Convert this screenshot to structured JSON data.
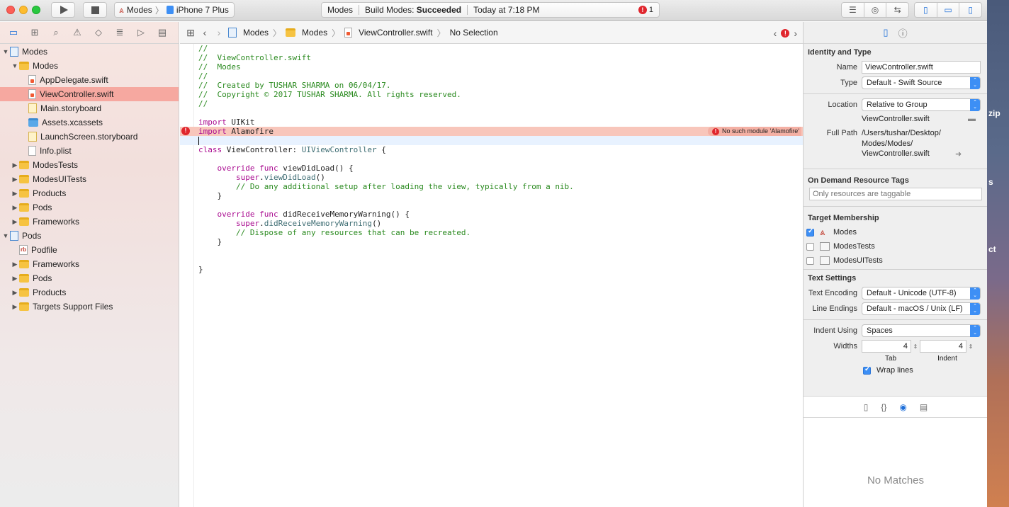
{
  "toolbar": {
    "scheme_target": "Modes",
    "scheme_device": "iPhone 7 Plus",
    "activity_project": "Modes",
    "activity_status_label": "Build Modes:",
    "activity_status_value": "Succeeded",
    "activity_time": "Today at 7:18 PM",
    "error_count": "1"
  },
  "navigator": {
    "items": [
      {
        "label": "Modes",
        "indent": 0,
        "icon": "project-icon",
        "disclosure": "▼"
      },
      {
        "label": "Modes",
        "indent": 1,
        "icon": "folder-icon",
        "disclosure": "▼"
      },
      {
        "label": "AppDelegate.swift",
        "indent": 2,
        "icon": "swift-file-icon",
        "disclosure": ""
      },
      {
        "label": "ViewController.swift",
        "indent": 2,
        "icon": "swift-file-icon",
        "disclosure": "",
        "selected": true
      },
      {
        "label": "Main.storyboard",
        "indent": 2,
        "icon": "storyboard-icon",
        "disclosure": ""
      },
      {
        "label": "Assets.xcassets",
        "indent": 2,
        "icon": "assets-folder-icon",
        "disclosure": ""
      },
      {
        "label": "LaunchScreen.storyboard",
        "indent": 2,
        "icon": "storyboard-icon",
        "disclosure": ""
      },
      {
        "label": "Info.plist",
        "indent": 2,
        "icon": "plist-file-icon",
        "disclosure": ""
      },
      {
        "label": "ModesTests",
        "indent": 1,
        "icon": "folder-icon",
        "disclosure": "▶"
      },
      {
        "label": "ModesUITests",
        "indent": 1,
        "icon": "folder-icon",
        "disclosure": "▶"
      },
      {
        "label": "Products",
        "indent": 1,
        "icon": "folder-icon",
        "disclosure": "▶"
      },
      {
        "label": "Pods",
        "indent": 1,
        "icon": "folder-icon",
        "disclosure": "▶"
      },
      {
        "label": "Frameworks",
        "indent": 1,
        "icon": "folder-icon",
        "disclosure": "▶"
      },
      {
        "label": "Pods",
        "indent": 0,
        "icon": "project-icon",
        "disclosure": "▼"
      },
      {
        "label": "Podfile",
        "indent": 1,
        "icon": "podfile-icon",
        "disclosure": ""
      },
      {
        "label": "Frameworks",
        "indent": 1,
        "icon": "folder-icon",
        "disclosure": "▶"
      },
      {
        "label": "Pods",
        "indent": 1,
        "icon": "folder-icon",
        "disclosure": "▶"
      },
      {
        "label": "Products",
        "indent": 1,
        "icon": "folder-icon",
        "disclosure": "▶"
      },
      {
        "label": "Targets Support Files",
        "indent": 1,
        "icon": "folder-icon",
        "disclosure": "▶"
      }
    ]
  },
  "jumpbar": {
    "crumb1": "Modes",
    "crumb2": "Modes",
    "crumb3": "ViewController.swift",
    "crumb4": "No Selection"
  },
  "editor": {
    "error_message": "No such module 'Alamofire'",
    "lines": [
      {
        "t": "//",
        "c": "cm"
      },
      {
        "t": "//  ViewController.swift",
        "c": "cm"
      },
      {
        "t": "//  Modes",
        "c": "cm"
      },
      {
        "t": "//",
        "c": "cm"
      },
      {
        "t": "//  Created by TUSHAR SHARMA on 06/04/17.",
        "c": "cm"
      },
      {
        "t": "//  Copyright © 2017 TUSHAR SHARMA. All rights reserved.",
        "c": "cm"
      },
      {
        "t": "//",
        "c": "cm"
      },
      {
        "t": "",
        "c": ""
      },
      {
        "t": "import UIKit",
        "c": "import"
      },
      {
        "t": "import Alamofire",
        "c": "import",
        "err": true
      },
      {
        "t": "",
        "c": "",
        "cursor": true
      },
      {
        "t": "class ViewController: UIViewController {",
        "c": "class"
      },
      {
        "t": "",
        "c": ""
      },
      {
        "t": "    override func viewDidLoad() {",
        "c": "func"
      },
      {
        "t": "        super.viewDidLoad()",
        "c": "super"
      },
      {
        "t": "        // Do any additional setup after loading the view, typically from a nib.",
        "c": "cm"
      },
      {
        "t": "    }",
        "c": ""
      },
      {
        "t": "",
        "c": ""
      },
      {
        "t": "    override func didReceiveMemoryWarning() {",
        "c": "func"
      },
      {
        "t": "        super.didReceiveMemoryWarning()",
        "c": "super"
      },
      {
        "t": "        // Dispose of any resources that can be recreated.",
        "c": "cm"
      },
      {
        "t": "    }",
        "c": ""
      },
      {
        "t": "",
        "c": ""
      },
      {
        "t": "",
        "c": ""
      },
      {
        "t": "}",
        "c": ""
      }
    ]
  },
  "inspector": {
    "identity_title": "Identity and Type",
    "name_label": "Name",
    "name_value": "ViewController.swift",
    "type_label": "Type",
    "type_value": "Default - Swift Source",
    "location_label": "Location",
    "location_value": "Relative to Group",
    "location_file": "ViewController.swift",
    "fullpath_label": "Full Path",
    "fullpath_1": "/Users/tushar/Desktop/",
    "fullpath_2": "Modes/Modes/",
    "fullpath_3": "ViewController.swift",
    "odr_title": "On Demand Resource Tags",
    "odr_placeholder": "Only resources are taggable",
    "target_title": "Target Membership",
    "targets": [
      {
        "label": "Modes",
        "checked": true,
        "icon": "app-target-icon"
      },
      {
        "label": "ModesTests",
        "checked": false,
        "icon": "test-target-icon"
      },
      {
        "label": "ModesUITests",
        "checked": false,
        "icon": "test-target-icon"
      }
    ],
    "text_title": "Text Settings",
    "encoding_label": "Text Encoding",
    "encoding_value": "Default - Unicode (UTF-8)",
    "endings_label": "Line Endings",
    "endings_value": "Default - macOS / Unix (LF)",
    "indent_label": "Indent Using",
    "indent_value": "Spaces",
    "widths_label": "Widths",
    "tab_value": "4",
    "tab_label": "Tab",
    "indent_width_value": "4",
    "indent_width_label": "Indent",
    "wrap_label": "Wrap lines",
    "no_matches": "No Matches"
  },
  "desktop": {
    "t1": "zip",
    "t2": "s",
    "t3": "ct"
  }
}
